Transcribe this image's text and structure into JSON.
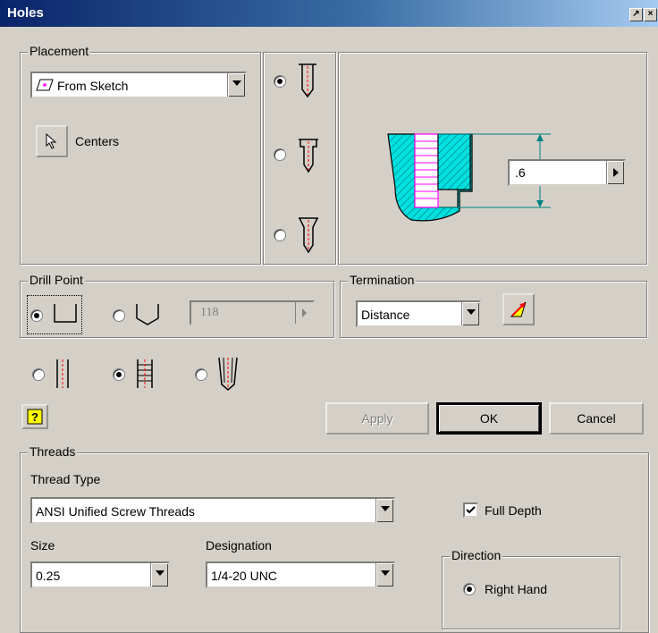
{
  "window": {
    "title": "Holes"
  },
  "placement": {
    "legend": "Placement",
    "method": "From Sketch",
    "centers_label": "Centers"
  },
  "preview": {
    "depth_value": ".6"
  },
  "hole_type": {
    "selected": "drilled",
    "options": [
      "drilled",
      "counterbore",
      "countersink"
    ]
  },
  "drill_point": {
    "legend": "Drill Point",
    "angle": "118",
    "selected": "flat"
  },
  "termination": {
    "legend": "Termination",
    "value": "Distance"
  },
  "hole_style": {
    "selected": "tapped",
    "options": [
      "simple",
      "tapped",
      "taper-tapped"
    ]
  },
  "buttons": {
    "apply": "Apply",
    "ok": "OK",
    "cancel": "Cancel"
  },
  "threads": {
    "legend": "Threads",
    "type_label": "Thread Type",
    "type_value": "ANSI Unified Screw Threads",
    "full_depth_label": "Full Depth",
    "full_depth_checked": true,
    "size_label": "Size",
    "size_value": "0.25",
    "designation_label": "Designation",
    "designation_value": "1/4-20 UNC",
    "direction_legend": "Direction",
    "direction_value": "Right Hand"
  },
  "colors": {
    "titlebar": "#0a246a",
    "hatch": "#00e0e0",
    "thread": "#ff00ff",
    "dimension": "#008080",
    "centerline": "#ff0000"
  }
}
